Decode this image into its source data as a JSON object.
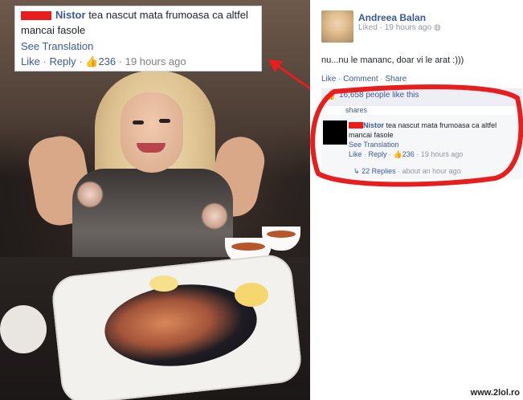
{
  "photo": {
    "description_icon": "photo"
  },
  "callout": {
    "name": "Nistor",
    "text_line1": "tea nascut mata frumoasa ca altfel",
    "text_line2": "mancai fasole",
    "see_translation": "See Translation",
    "like": "Like",
    "reply": "Reply",
    "like_count": "236",
    "time": "19 hours ago"
  },
  "post": {
    "author": "Andreea Balan",
    "time": "Liked · 19 hours ago",
    "text": "nu...nu le mananc, doar vi le arat :)))",
    "actions": {
      "like": "Like",
      "comment": "Comment",
      "share": "Share"
    },
    "likes_text": "16,658 people like this",
    "shares_text": "shares"
  },
  "comment": {
    "name": "Nistor",
    "text_line1": "tea nascut mata frumoasa ca altfel",
    "text_line2": "mancai fasole",
    "see_translation": "See Translation",
    "like": "Like",
    "reply": "Reply",
    "like_count": "236",
    "time": "19 hours ago",
    "replies": "22 Replies",
    "replies_age": "about an hour ago"
  },
  "watermark": "www.2lol.ro",
  "colors": {
    "fb_blue": "#3b5998",
    "annotation_red": "#e81d1d"
  }
}
